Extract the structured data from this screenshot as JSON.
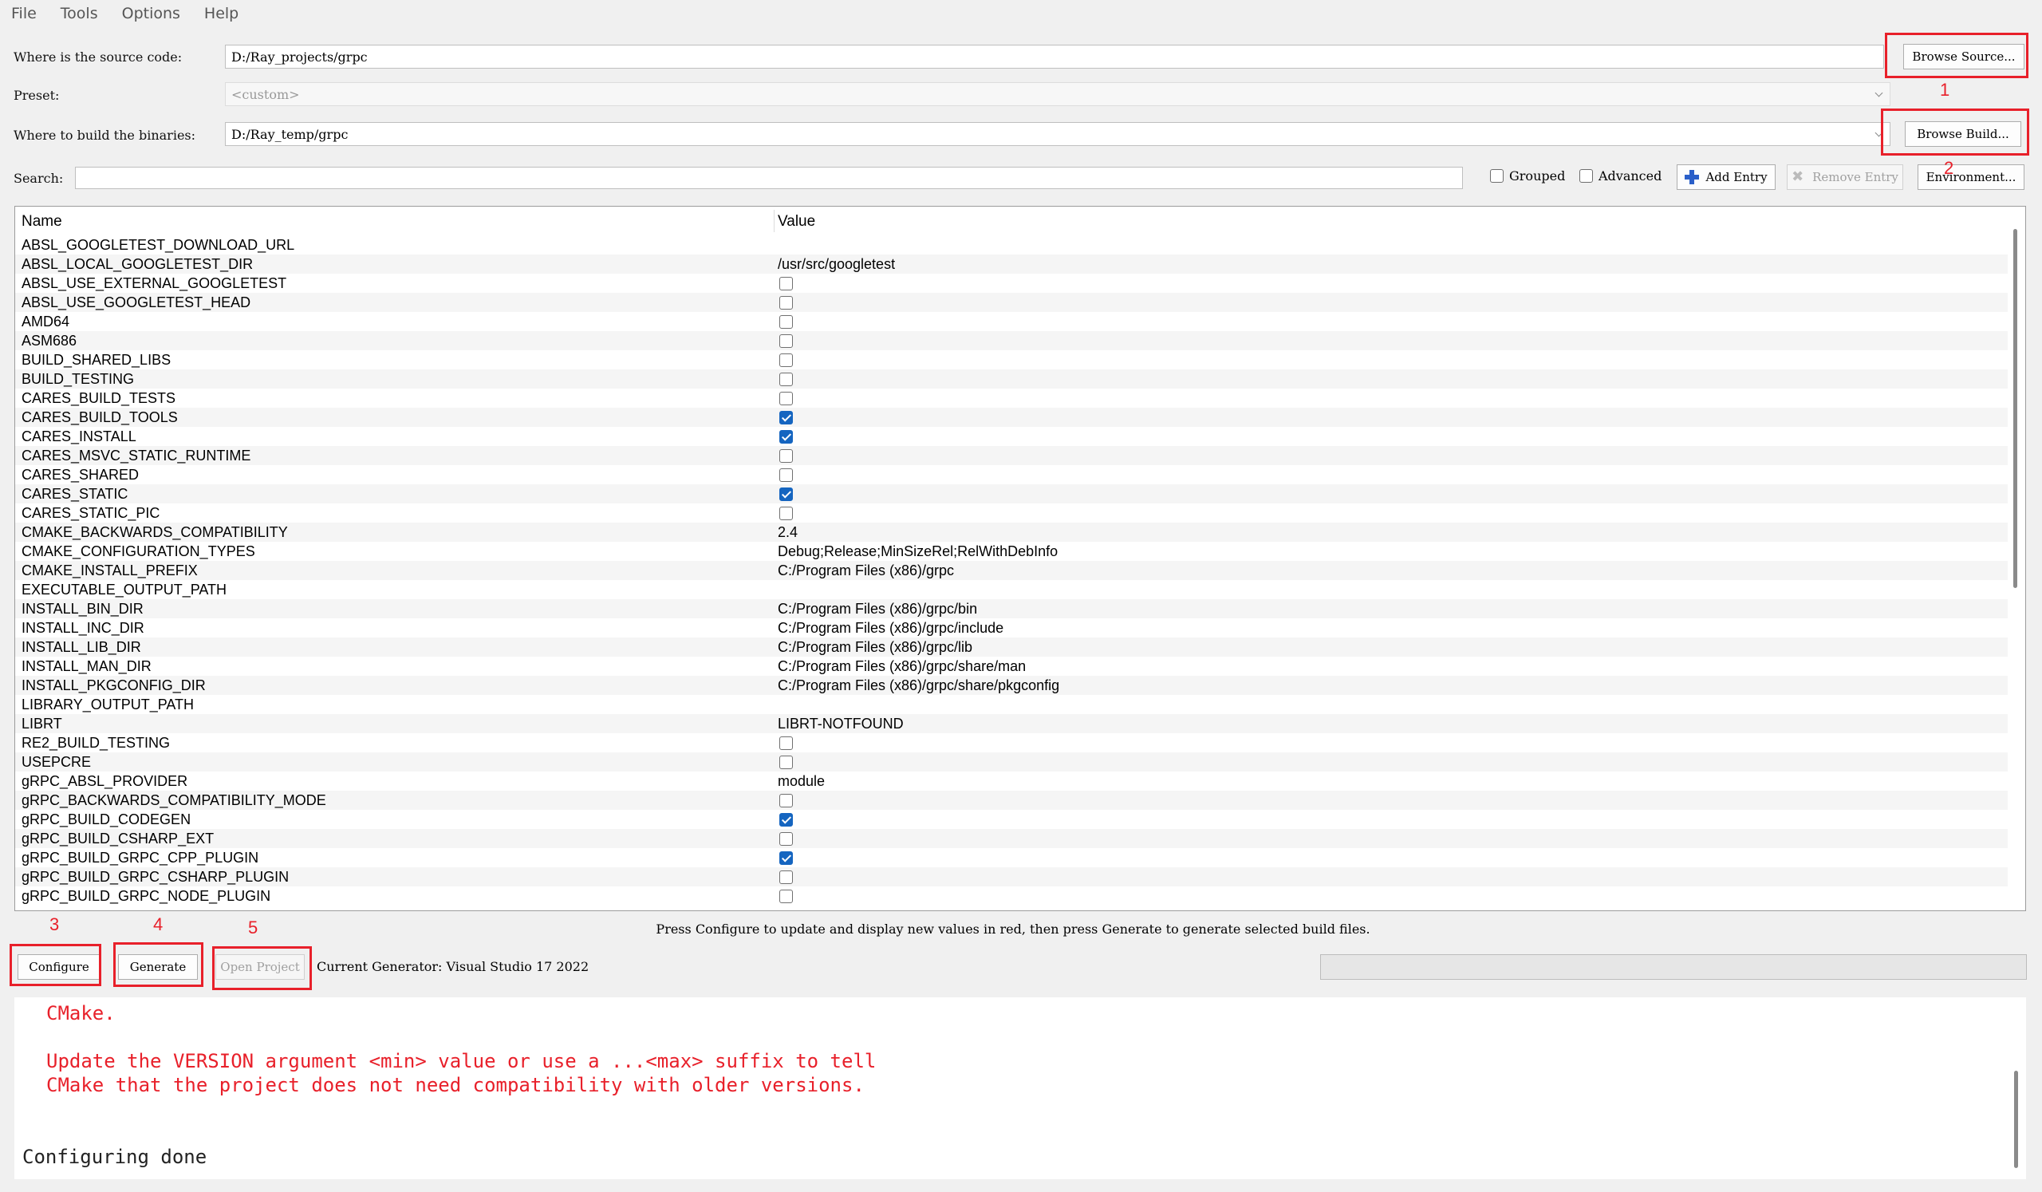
{
  "menu": [
    "File",
    "Tools",
    "Options",
    "Help"
  ],
  "source": {
    "label": "Where is the source code:",
    "value": "D:/Ray_projects/grpc",
    "browse_label": "Browse Source..."
  },
  "preset": {
    "label": "Preset:",
    "value": "<custom>"
  },
  "build": {
    "label": "Where to build the binaries:",
    "value": "D:/Ray_temp/grpc",
    "browse_label": "Browse Build..."
  },
  "search": {
    "label": "Search:",
    "value": ""
  },
  "toolbar": {
    "grouped_label": "Grouped",
    "advanced_label": "Advanced",
    "add_entry_label": "Add Entry",
    "remove_entry_label": "Remove Entry",
    "environment_label": "Environment..."
  },
  "table": {
    "headers": [
      "Name",
      "Value"
    ],
    "rows": [
      {
        "name": "ABSL_GOOGLETEST_DOWNLOAD_URL",
        "type": "text",
        "value": ""
      },
      {
        "name": "ABSL_LOCAL_GOOGLETEST_DIR",
        "type": "text",
        "value": "/usr/src/googletest"
      },
      {
        "name": "ABSL_USE_EXTERNAL_GOOGLETEST",
        "type": "bool",
        "value": false
      },
      {
        "name": "ABSL_USE_GOOGLETEST_HEAD",
        "type": "bool",
        "value": false
      },
      {
        "name": "AMD64",
        "type": "bool",
        "value": false
      },
      {
        "name": "ASM686",
        "type": "bool",
        "value": false
      },
      {
        "name": "BUILD_SHARED_LIBS",
        "type": "bool",
        "value": false
      },
      {
        "name": "BUILD_TESTING",
        "type": "bool",
        "value": false
      },
      {
        "name": "CARES_BUILD_TESTS",
        "type": "bool",
        "value": false
      },
      {
        "name": "CARES_BUILD_TOOLS",
        "type": "bool",
        "value": true
      },
      {
        "name": "CARES_INSTALL",
        "type": "bool",
        "value": true
      },
      {
        "name": "CARES_MSVC_STATIC_RUNTIME",
        "type": "bool",
        "value": false
      },
      {
        "name": "CARES_SHARED",
        "type": "bool",
        "value": false
      },
      {
        "name": "CARES_STATIC",
        "type": "bool",
        "value": true
      },
      {
        "name": "CARES_STATIC_PIC",
        "type": "bool",
        "value": false
      },
      {
        "name": "CMAKE_BACKWARDS_COMPATIBILITY",
        "type": "text",
        "value": "2.4"
      },
      {
        "name": "CMAKE_CONFIGURATION_TYPES",
        "type": "text",
        "value": "Debug;Release;MinSizeRel;RelWithDebInfo"
      },
      {
        "name": "CMAKE_INSTALL_PREFIX",
        "type": "text",
        "value": "C:/Program Files (x86)/grpc"
      },
      {
        "name": "EXECUTABLE_OUTPUT_PATH",
        "type": "text",
        "value": ""
      },
      {
        "name": "INSTALL_BIN_DIR",
        "type": "text",
        "value": "C:/Program Files (x86)/grpc/bin"
      },
      {
        "name": "INSTALL_INC_DIR",
        "type": "text",
        "value": "C:/Program Files (x86)/grpc/include"
      },
      {
        "name": "INSTALL_LIB_DIR",
        "type": "text",
        "value": "C:/Program Files (x86)/grpc/lib"
      },
      {
        "name": "INSTALL_MAN_DIR",
        "type": "text",
        "value": "C:/Program Files (x86)/grpc/share/man"
      },
      {
        "name": "INSTALL_PKGCONFIG_DIR",
        "type": "text",
        "value": "C:/Program Files (x86)/grpc/share/pkgconfig"
      },
      {
        "name": "LIBRARY_OUTPUT_PATH",
        "type": "text",
        "value": ""
      },
      {
        "name": "LIBRT",
        "type": "text",
        "value": "LIBRT-NOTFOUND"
      },
      {
        "name": "RE2_BUILD_TESTING",
        "type": "bool",
        "value": false
      },
      {
        "name": "USEPCRE",
        "type": "bool",
        "value": false
      },
      {
        "name": "gRPC_ABSL_PROVIDER",
        "type": "text",
        "value": "module"
      },
      {
        "name": "gRPC_BACKWARDS_COMPATIBILITY_MODE",
        "type": "bool",
        "value": false
      },
      {
        "name": "gRPC_BUILD_CODEGEN",
        "type": "bool",
        "value": true
      },
      {
        "name": "gRPC_BUILD_CSHARP_EXT",
        "type": "bool",
        "value": false
      },
      {
        "name": "gRPC_BUILD_GRPC_CPP_PLUGIN",
        "type": "bool",
        "value": true
      },
      {
        "name": "gRPC_BUILD_GRPC_CSHARP_PLUGIN",
        "type": "bool",
        "value": false
      },
      {
        "name": "gRPC_BUILD_GRPC_NODE_PLUGIN",
        "type": "bool",
        "value": false
      }
    ]
  },
  "hint": "Press Configure to update and display new values in red, then press Generate to generate selected build files.",
  "actions": {
    "configure_label": "Configure",
    "generate_label": "Generate",
    "open_project_label": "Open Project"
  },
  "generator": "Current Generator: Visual Studio 17 2022",
  "annotations": [
    "1",
    "2",
    "3",
    "4",
    "5"
  ],
  "output": {
    "lines": [
      {
        "text": "CMake.",
        "color": "red"
      },
      {
        "text": "Update the VERSION argument <min> value or use a ...<max> suffix to tell",
        "color": "red"
      },
      {
        "text": "CMake that the project does not need compatibility with older versions.",
        "color": "red"
      },
      {
        "text": "Configuring done",
        "color": "black"
      }
    ]
  },
  "colors": {
    "annotation_red": "#e8202a",
    "checked_blue": "#1565c0"
  }
}
